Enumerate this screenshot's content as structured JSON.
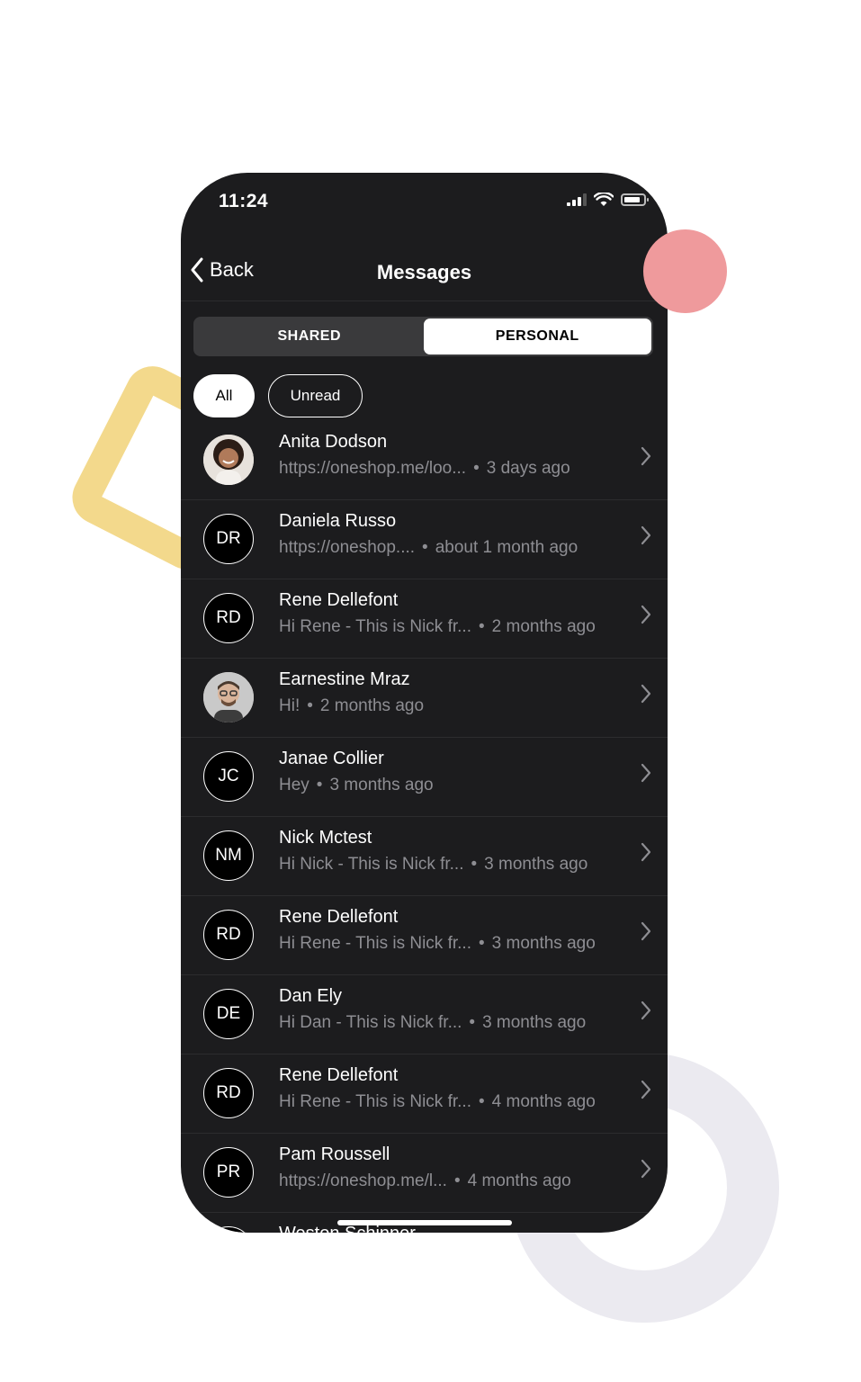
{
  "status": {
    "time": "11:24"
  },
  "nav": {
    "back_label": "Back",
    "title": "Messages"
  },
  "segments": [
    {
      "label": "SHARED",
      "active": false
    },
    {
      "label": "PERSONAL",
      "active": true
    }
  ],
  "filters": [
    {
      "label": "All",
      "active": true
    },
    {
      "label": "Unread",
      "active": false
    }
  ],
  "conversations": [
    {
      "name": "Anita Dodson",
      "initials": "",
      "photo": "woman",
      "preview": "https://oneshop.me/loo...",
      "time": "3 days ago"
    },
    {
      "name": "Daniela Russo",
      "initials": "DR",
      "photo": "",
      "preview": "https://oneshop....",
      "time": "about 1 month ago"
    },
    {
      "name": "Rene Dellefont",
      "initials": "RD",
      "photo": "",
      "preview": "Hi Rene - This is Nick fr...",
      "time": "2 months ago"
    },
    {
      "name": "Earnestine Mraz",
      "initials": "",
      "photo": "man",
      "preview": "Hi!",
      "time": "2 months ago"
    },
    {
      "name": "Janae Collier",
      "initials": "JC",
      "photo": "",
      "preview": "Hey",
      "time": "3 months ago"
    },
    {
      "name": "Nick Mctest",
      "initials": "NM",
      "photo": "",
      "preview": "Hi Nick - This is Nick fr...",
      "time": "3 months ago"
    },
    {
      "name": "Rene Dellefont",
      "initials": "RD",
      "photo": "",
      "preview": "Hi Rene - This is Nick fr...",
      "time": "3 months ago"
    },
    {
      "name": "Dan Ely",
      "initials": "DE",
      "photo": "",
      "preview": "Hi Dan - This is Nick fr...",
      "time": "3 months ago"
    },
    {
      "name": "Rene Dellefont",
      "initials": "RD",
      "photo": "",
      "preview": "Hi Rene - This is Nick fr...",
      "time": "4 months ago"
    },
    {
      "name": "Pam Roussell",
      "initials": "PR",
      "photo": "",
      "preview": "https://oneshop.me/l...",
      "time": "4 months ago"
    },
    {
      "name": "Weston Schinner",
      "initials": "",
      "photo": "",
      "preview": "",
      "time": ""
    }
  ],
  "colors": {
    "background": "#1c1c1e",
    "accent_pink": "#ef9a9c",
    "accent_yellow": "#f3d98c",
    "ring": "#ebeaf0",
    "muted_text": "#8e8e93"
  }
}
